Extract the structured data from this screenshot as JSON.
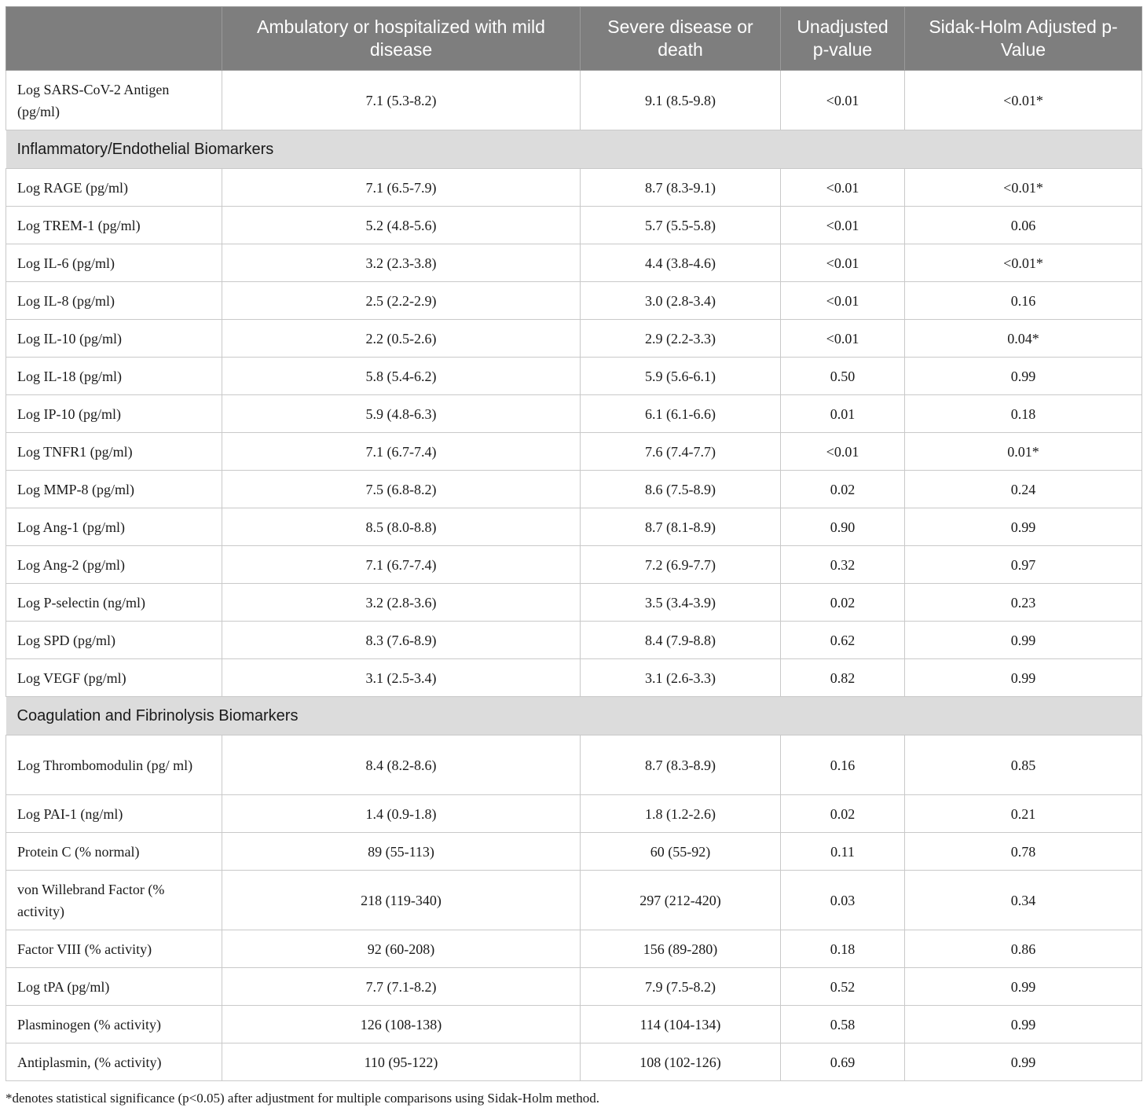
{
  "header": {
    "col1": "",
    "col2": "Ambulatory or hospitalized with mild disease",
    "col3": "Severe disease or death",
    "col4": "Unadjusted p-value",
    "col5": "Sidak-Holm Adjusted p-Value"
  },
  "rows": [
    {
      "type": "data",
      "tall": true,
      "name": "Log SARS-CoV-2 Antigen (pg/ml)",
      "mild": "7.1 (5.3-8.2)",
      "severe": "9.1 (8.5-9.8)",
      "p": "<0.01",
      "adj": "<0.01*"
    },
    {
      "type": "section",
      "label": "Inflammatory/Endothelial Biomarkers"
    },
    {
      "type": "data",
      "name": "Log RAGE (pg/ml)",
      "mild": "7.1 (6.5-7.9)",
      "severe": "8.7 (8.3-9.1)",
      "p": "<0.01",
      "adj": "<0.01*"
    },
    {
      "type": "data",
      "name": "Log TREM-1 (pg/ml)",
      "mild": "5.2 (4.8-5.6)",
      "severe": "5.7 (5.5-5.8)",
      "p": "<0.01",
      "adj": "0.06"
    },
    {
      "type": "data",
      "name": "Log IL-6 (pg/ml)",
      "mild": "3.2 (2.3-3.8)",
      "severe": "4.4 (3.8-4.6)",
      "p": "<0.01",
      "adj": "<0.01*"
    },
    {
      "type": "data",
      "name": "Log IL-8 (pg/ml)",
      "mild": "2.5 (2.2-2.9)",
      "severe": "3.0 (2.8-3.4)",
      "p": "<0.01",
      "adj": "0.16"
    },
    {
      "type": "data",
      "name": "Log IL-10 (pg/ml)",
      "mild": "2.2 (0.5-2.6)",
      "severe": "2.9 (2.2-3.3)",
      "p": "<0.01",
      "adj": "0.04*"
    },
    {
      "type": "data",
      "name": "Log IL-18 (pg/ml)",
      "mild": "5.8 (5.4-6.2)",
      "severe": "5.9 (5.6-6.1)",
      "p": "0.50",
      "adj": "0.99"
    },
    {
      "type": "data",
      "name": "Log IP-10 (pg/ml)",
      "mild": "5.9 (4.8-6.3)",
      "severe": "6.1 (6.1-6.6)",
      "p": "0.01",
      "adj": "0.18"
    },
    {
      "type": "data",
      "name": "Log TNFR1 (pg/ml)",
      "mild": "7.1 (6.7-7.4)",
      "severe": "7.6 (7.4-7.7)",
      "p": "<0.01",
      "adj": "0.01*"
    },
    {
      "type": "data",
      "name": "Log MMP-8 (pg/ml)",
      "mild": "7.5 (6.8-8.2)",
      "severe": "8.6 (7.5-8.9)",
      "p": "0.02",
      "adj": "0.24"
    },
    {
      "type": "data",
      "name": "Log Ang-1 (pg/ml)",
      "mild": "8.5 (8.0-8.8)",
      "severe": "8.7 (8.1-8.9)",
      "p": "0.90",
      "adj": "0.99"
    },
    {
      "type": "data",
      "name": "Log Ang-2 (pg/ml)",
      "mild": "7.1 (6.7-7.4)",
      "severe": "7.2 (6.9-7.7)",
      "p": "0.32",
      "adj": "0.97"
    },
    {
      "type": "data",
      "name": "Log P-selectin (ng/ml)",
      "mild": "3.2 (2.8-3.6)",
      "severe": "3.5 (3.4-3.9)",
      "p": "0.02",
      "adj": "0.23"
    },
    {
      "type": "data",
      "name": "Log SPD (pg/ml)",
      "mild": "8.3 (7.6-8.9)",
      "severe": "8.4 (7.9-8.8)",
      "p": "0.62",
      "adj": "0.99"
    },
    {
      "type": "data",
      "name": "Log VEGF (pg/ml)",
      "mild": "3.1 (2.5-3.4)",
      "severe": "3.1 (2.6-3.3)",
      "p": "0.82",
      "adj": "0.99"
    },
    {
      "type": "section",
      "label": "Coagulation and Fibrinolysis Biomarkers"
    },
    {
      "type": "data",
      "tall": true,
      "name": "Log Thrombomodulin (pg/ ml)",
      "mild": "8.4 (8.2-8.6)",
      "severe": "8.7 (8.3-8.9)",
      "p": "0.16",
      "adj": "0.85"
    },
    {
      "type": "data",
      "name": "Log PAI-1 (ng/ml)",
      "mild": "1.4 (0.9-1.8)",
      "severe": "1.8 (1.2-2.6)",
      "p": "0.02",
      "adj": "0.21"
    },
    {
      "type": "data",
      "name": "Protein C (% normal)",
      "mild": "89 (55-113)",
      "severe": "60 (55-92)",
      "p": "0.11",
      "adj": "0.78"
    },
    {
      "type": "data",
      "tall": true,
      "name": "von Willebrand Factor (% activity)",
      "mild": "218 (119-340)",
      "severe": "297 (212-420)",
      "p": "0.03",
      "adj": "0.34"
    },
    {
      "type": "data",
      "name": "Factor VIII (% activity)",
      "mild": "92 (60-208)",
      "severe": "156 (89-280)",
      "p": "0.18",
      "adj": "0.86"
    },
    {
      "type": "data",
      "name": "Log tPA (pg/ml)",
      "mild": "7.7 (7.1-8.2)",
      "severe": "7.9 (7.5-8.2)",
      "p": "0.52",
      "adj": "0.99"
    },
    {
      "type": "data",
      "name": "Plasminogen (% activity)",
      "mild": "126 (108-138)",
      "severe": "114 (104-134)",
      "p": "0.58",
      "adj": "0.99"
    },
    {
      "type": "data",
      "name": "Antiplasmin, (% activity)",
      "mild": "110 (95-122)",
      "severe": "108 (102-126)",
      "p": "0.69",
      "adj": "0.99"
    }
  ],
  "footnote": "*denotes statistical significance (p<0.05) after adjustment for multiple comparisons using Sidak-Holm method."
}
